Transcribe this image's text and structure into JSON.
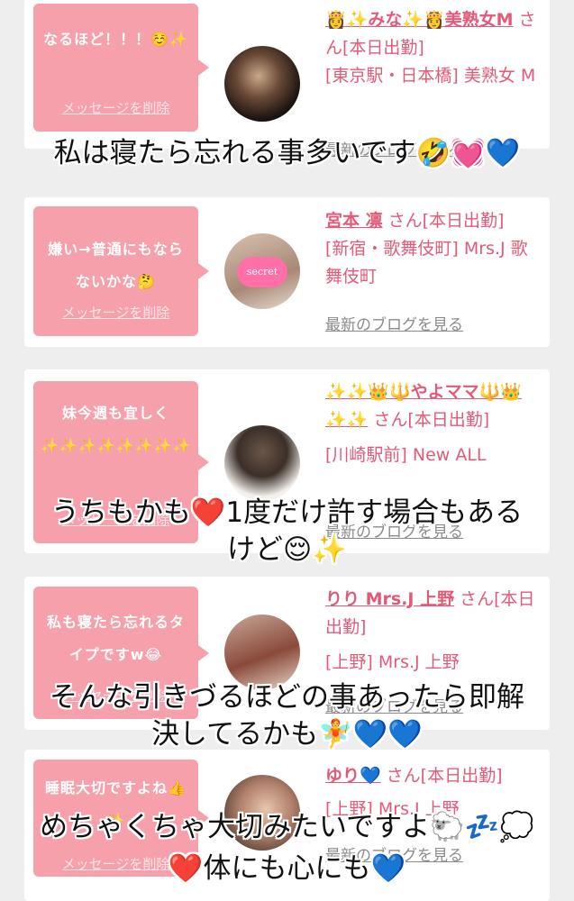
{
  "cards": [
    {
      "message": "なるほど！！！☺️✨",
      "delete_label": "メッセージを削除",
      "name": "👸✨みな✨👸美熟女M",
      "suffix": "さん[本日出勤]",
      "area": "[東京駅・日本橋] 美熟女 M",
      "blog": "最新のブログを見る"
    },
    {
      "message": "嫌い→普通にもならないかな🤔",
      "delete_label": "メッセージを削除",
      "name": "宮本 凛",
      "suffix": "さん[本日出勤]",
      "area": "[新宿・歌舞伎町] Mrs.J 歌舞伎町",
      "blog": "最新のブログを見る",
      "avatar_text": "secret"
    },
    {
      "message": "妹今週も宜しく✨✨✨✨✨✨✨✨",
      "delete_label": "メッセージを削除",
      "name": "✨✨👑🔱やよママ🔱👑✨✨",
      "suffix": "さん[本日出勤]",
      "area": "[川崎駅前] New ALL",
      "blog": "最新のブログを見る"
    },
    {
      "message": "私も寝たら忘れるタイプですw😂",
      "delete_label": "メッセージを削除",
      "name": "りり Mrs.J 上野",
      "suffix": "さん[本日出勤]",
      "area": "[上野] Mrs.J 上野",
      "blog": "最新のブログを見る"
    },
    {
      "message": "睡眠大切ですよね👍✨",
      "delete_label": "メッセージを削除",
      "name": "ゆり💙",
      "suffix": "さん[本日出勤]",
      "area": "[上野] Mrs.J 上野",
      "blog": "最新のブログを見る"
    }
  ],
  "captions": [
    "私は寝たら忘れる事多いです🤣💓💙",
    "うちもかも❤️1度だけ許す場合もある",
    "けど😌✨",
    "そんな引きづるほどの事あったら即解",
    "決してるかも🧚💙💙",
    "めちゃくちゃ大切みたいですよ🐑💤💭",
    "❤️体にも心にも💙"
  ],
  "colors": {
    "bubble": "#f6a0ac",
    "name": "#e35a78",
    "background": "#efeeef"
  }
}
